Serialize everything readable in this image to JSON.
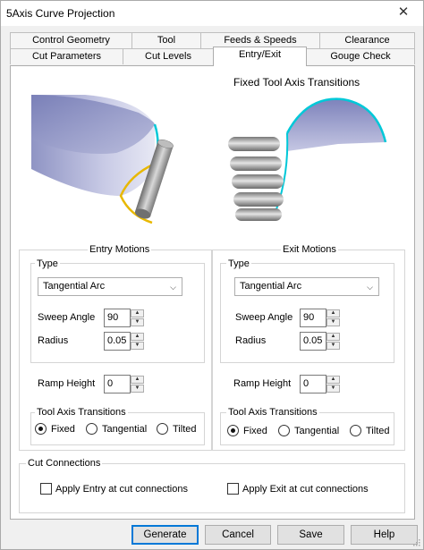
{
  "window": {
    "title": "5Axis Curve Projection",
    "close_icon": "close-icon"
  },
  "tabs_row1": [
    "Control Geometry",
    "Tool",
    "Feeds & Speeds",
    "Clearance"
  ],
  "tabs_row2": [
    "Cut Parameters",
    "Cut Levels",
    "Entry/Exit",
    "Gouge Check"
  ],
  "active_tab": "Entry/Exit",
  "illustration": {
    "caption": "Fixed Tool Axis Transitions"
  },
  "entry": {
    "group_label": "Entry Motions",
    "type_label": "Type",
    "type_value": "Tangential Arc",
    "sweep_label": "Sweep Angle",
    "sweep_value": "90",
    "radius_label": "Radius",
    "radius_value": "0.05",
    "ramp_label": "Ramp Height",
    "ramp_value": "0",
    "transitions_label": "Tool Axis Transitions",
    "radio_fixed": "Fixed",
    "radio_tangential": "Tangential",
    "radio_tilted": "Tilted",
    "selected": "Fixed"
  },
  "exit": {
    "group_label": "Exit Motions",
    "type_label": "Type",
    "type_value": "Tangential Arc",
    "sweep_label": "Sweep Angle",
    "sweep_value": "90",
    "radius_label": "Radius",
    "radius_value": "0.05",
    "ramp_label": "Ramp Height",
    "ramp_value": "0",
    "transitions_label": "Tool Axis Transitions",
    "radio_fixed": "Fixed",
    "radio_tangential": "Tangential",
    "radio_tilted": "Tilted",
    "selected": "Fixed"
  },
  "cut_connections": {
    "label": "Cut Connections",
    "apply_entry": "Apply Entry at cut connections",
    "apply_exit": "Apply Exit at cut connections"
  },
  "buttons": {
    "generate": "Generate",
    "cancel": "Cancel",
    "save": "Save",
    "help": "Help"
  },
  "colors": {
    "accent": "#0078d7",
    "arc_entry": "#e8b800",
    "arc_exit": "#00c8d8",
    "shape": "#a6aacf"
  }
}
